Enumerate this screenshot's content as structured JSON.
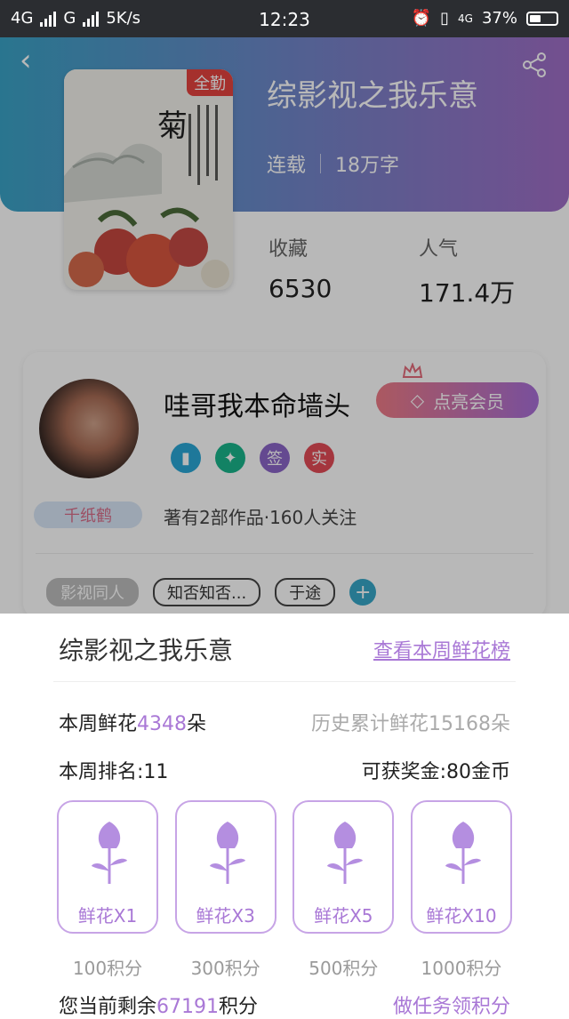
{
  "status_bar": {
    "signal_left": "4G",
    "signal_g": "G",
    "speed": "5K/s",
    "time": "12:23",
    "network": "4G",
    "battery": "37%"
  },
  "book": {
    "badge": "全勤",
    "title": "综影视之我乐意",
    "status": "连载",
    "word_count": "18万字",
    "favorites_label": "收藏",
    "favorites_value": "6530",
    "popularity_label": "人气",
    "popularity_value": "171.4万",
    "cover_char": "菊"
  },
  "author": {
    "name": "哇哥我本命墙头",
    "vip_button": "点亮会员",
    "honor_badges": [
      {
        "label": "",
        "color": "#2aa7d6",
        "icon": "book-icon"
      },
      {
        "label": "",
        "color": "#1ab58b",
        "icon": "handshake-icon"
      },
      {
        "label": "签",
        "color": "#8b66c8"
      },
      {
        "label": "实",
        "color": "#e34c57"
      }
    ],
    "crane_tag": "千纸鹤",
    "works": "著有2部作品·160人关注",
    "tags": [
      "影视同人",
      "知否知否...",
      "于途"
    ],
    "add_tag": "+"
  },
  "sheet": {
    "title": "综影视之我乐意",
    "link": "查看本周鲜花榜",
    "weekly_prefix": "本周鲜花",
    "weekly_value": "4348",
    "weekly_suffix": "朵",
    "history": "历史累计鲜花15168朵",
    "rank": "本周排名:11",
    "bonus": "可获奖金:80金币",
    "options": [
      {
        "label": "鲜花X1",
        "points": "100积分"
      },
      {
        "label": "鲜花X3",
        "points": "300积分"
      },
      {
        "label": "鲜花X5",
        "points": "500积分"
      },
      {
        "label": "鲜花X10",
        "points": "1000积分"
      }
    ],
    "remain_prefix": "您当前剩余",
    "remain_value": "67191",
    "remain_suffix": "积分",
    "task_link": "做任务领积分"
  },
  "colors": {
    "accent": "#a978d6",
    "header_start": "#3aa3c7",
    "header_end": "#a06ec7"
  }
}
